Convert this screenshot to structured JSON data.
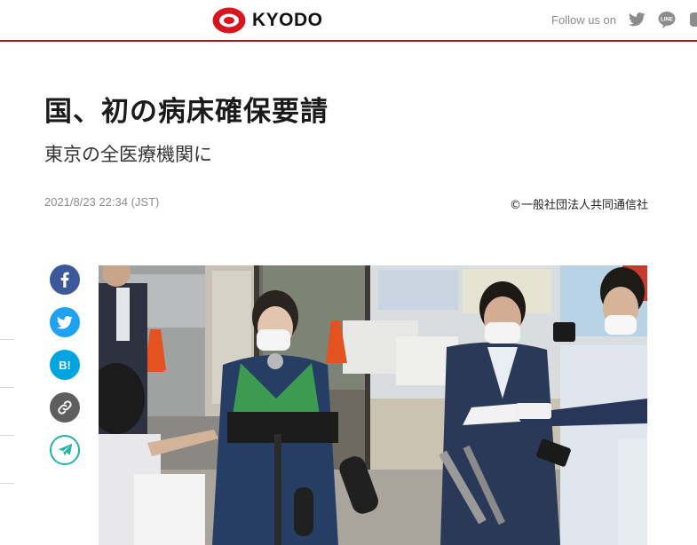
{
  "header": {
    "logo_text": "KYODO",
    "follow_label": "Follow us on",
    "sns_icons": [
      "twitter-icon",
      "line-icon",
      "more-icon"
    ]
  },
  "article": {
    "title": "国、初の病床確保要請",
    "subtitle": "東京の全医療機関に",
    "datetime": "2021/8/23 22:34 (JST)",
    "credit": "©一般社団法人共同通信社"
  },
  "share": {
    "items": [
      "facebook-icon",
      "twitter-icon",
      "hatena-bookmark-icon",
      "link-icon",
      "save-icon"
    ],
    "hatena_label": "B!"
  },
  "colors": {
    "brand_red": "#d8141d",
    "header_rule": "#9b1c1c",
    "facebook": "#3b5998",
    "twitter": "#1da1f2",
    "hatena": "#00a4de",
    "link": "#5e5e5e",
    "save": "#23b3a8"
  }
}
